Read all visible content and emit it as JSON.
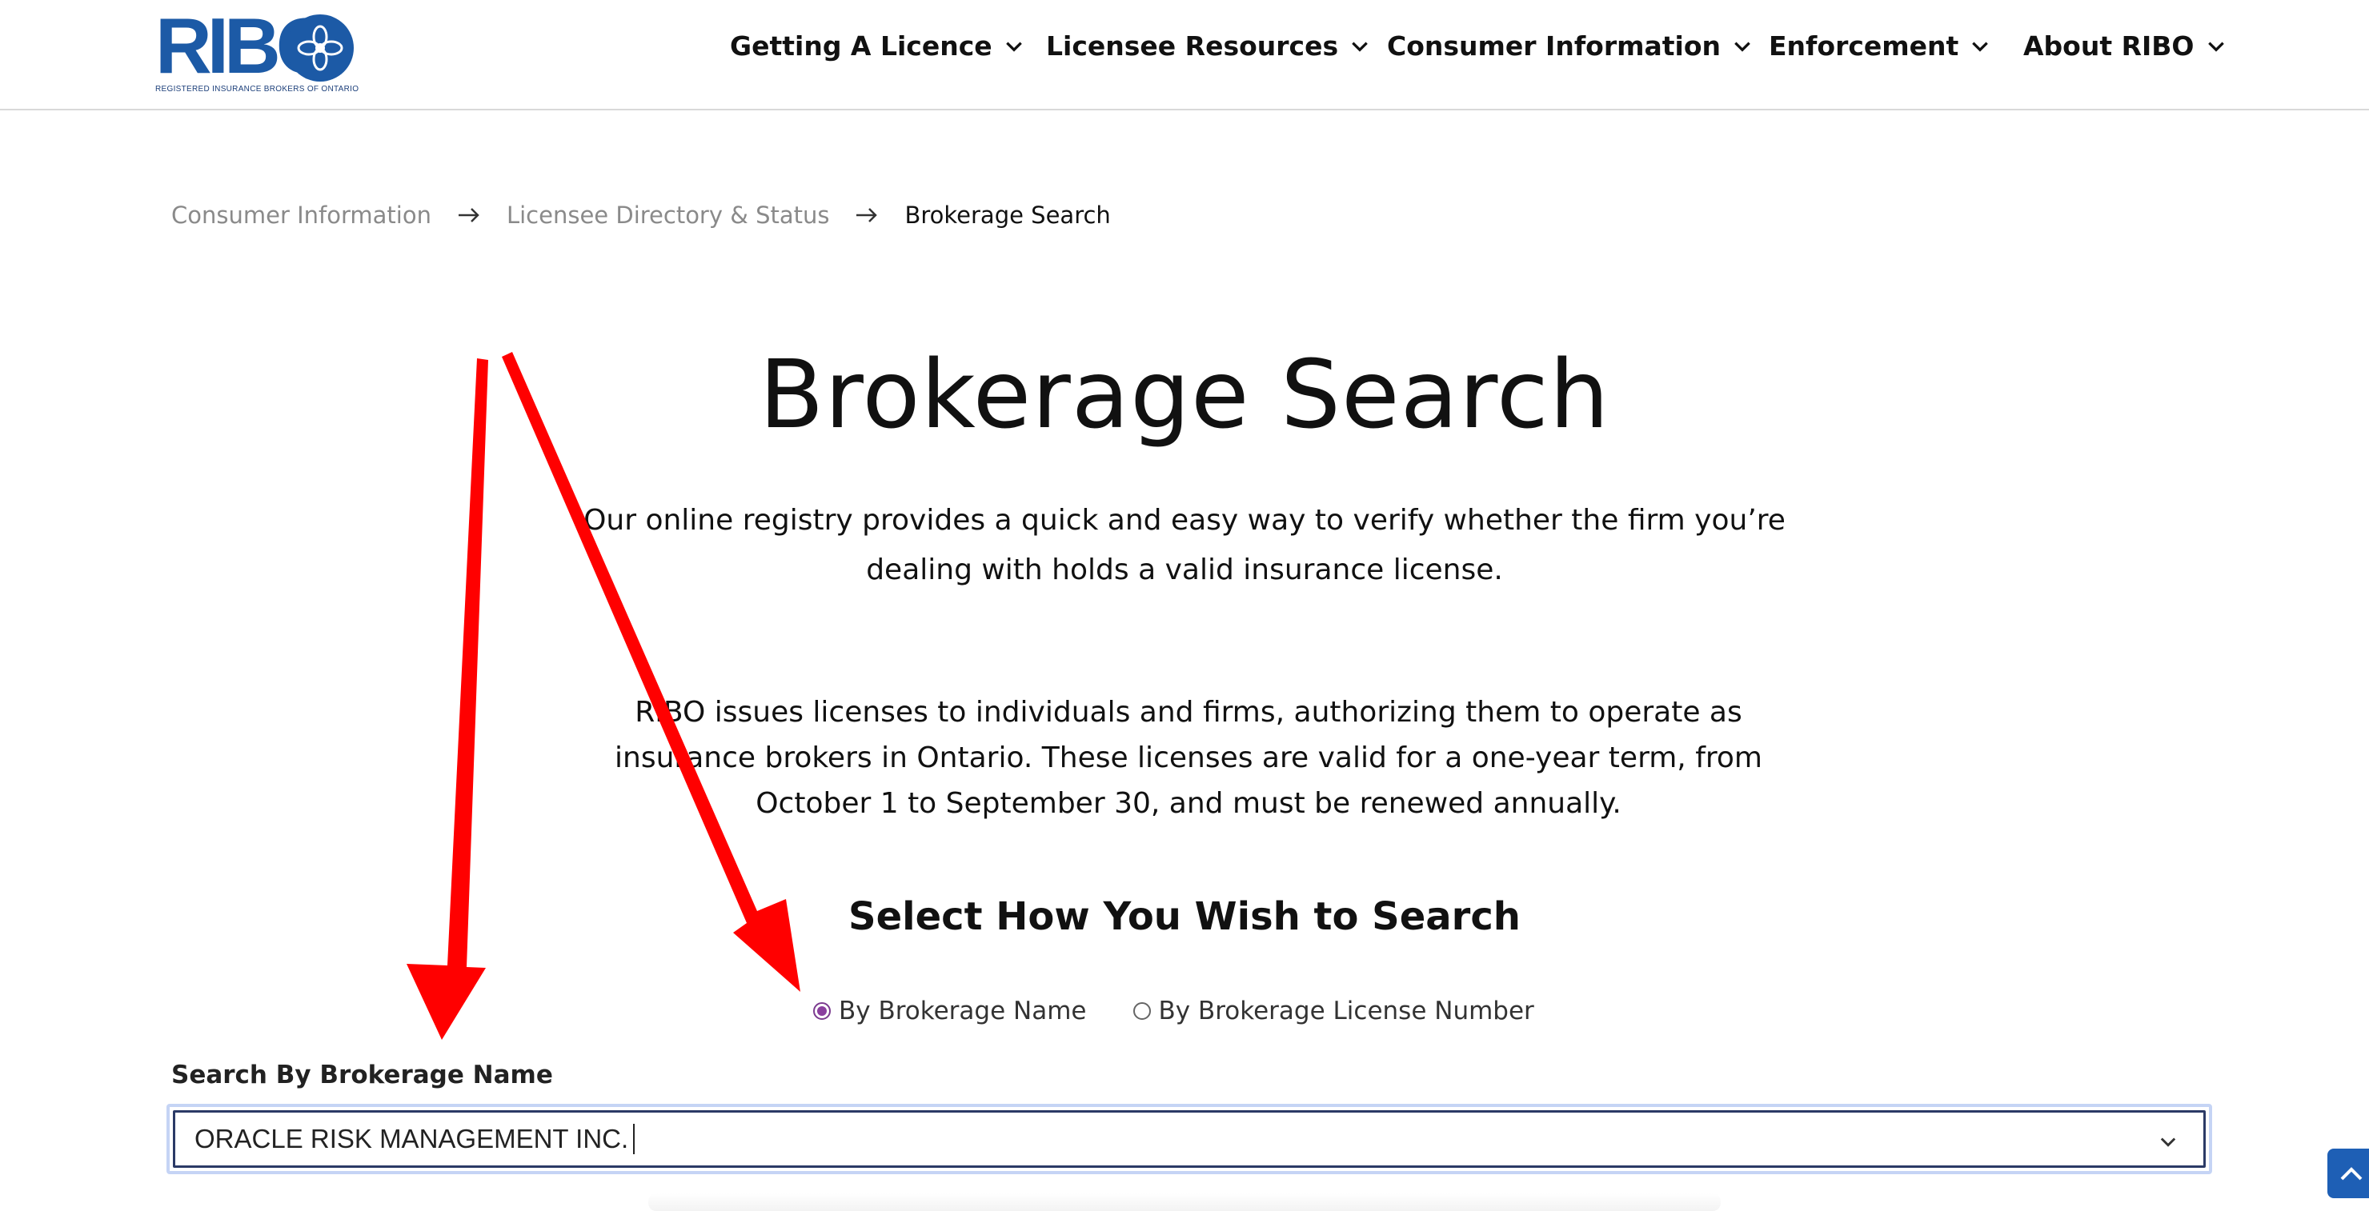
{
  "logo": {
    "text": "RIBO",
    "subtitle": "REGISTERED INSURANCE BROKERS OF ONTARIO",
    "brand_color": "#1c5aa6"
  },
  "nav": {
    "items": [
      {
        "label": "Getting A Licence",
        "icon": "chevron-down-icon"
      },
      {
        "label": "Licensee Resources",
        "icon": "chevron-down-icon"
      },
      {
        "label": "Consumer Information",
        "icon": "chevron-down-icon"
      },
      {
        "label": "Enforcement",
        "icon": "chevron-down-icon"
      },
      {
        "label": "About RIBO",
        "icon": "chevron-down-icon"
      }
    ]
  },
  "breadcrumb": {
    "items": [
      {
        "label": "Consumer Information"
      },
      {
        "label": "Licensee Directory & Status"
      },
      {
        "label": "Brokerage Search"
      }
    ],
    "separator_icon": "arrow-right-icon"
  },
  "main": {
    "title": "Brokerage Search",
    "intro": "Our online registry provides a quick and easy way to verify whether the firm you’re dealing with holds a valid insurance license.",
    "description": "RIBO issues licenses to individuals and firms, authorizing them to operate as insurance brokers in Ontario. These licenses are valid for a one-year term, from October 1 to September 30, and must be renewed annually.",
    "search_heading": "Select How You Wish to Search",
    "radio_options": [
      {
        "label": "By Brokerage Name",
        "checked": true
      },
      {
        "label": "By Brokerage License Number",
        "checked": false
      }
    ],
    "field_label": "Search By Brokerage Name",
    "field_value": "ORACLE RISK MANAGEMENT INC.",
    "field_icon": "chevron-down-icon"
  },
  "scroll_top": {
    "icon": "chevron-up-icon",
    "color": "#1e5fb5"
  },
  "annotation": {
    "color": "#ff0000",
    "shape": "arrow"
  },
  "colors": {
    "radio_accent": "#8a3f9e",
    "field_border": "#2b3a66",
    "field_focus_ring": "#c5d4f5"
  }
}
